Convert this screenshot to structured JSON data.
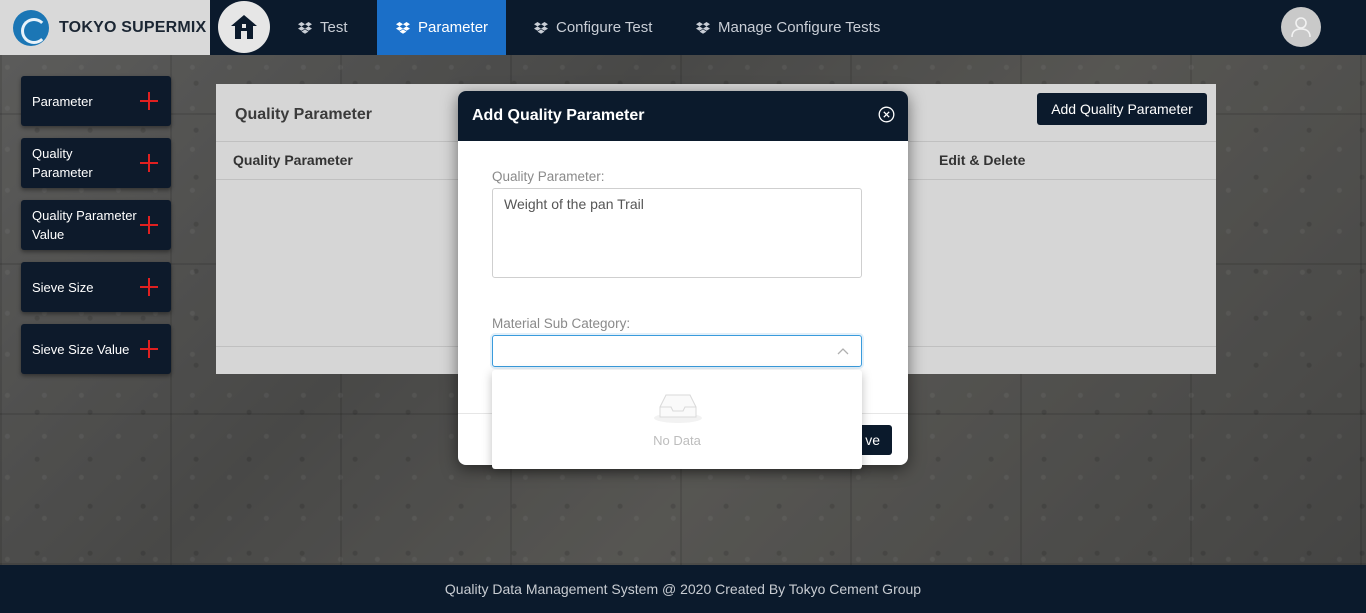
{
  "brand": {
    "name": "TOKYO SUPERMIX",
    "logo_icon": "spiral-logo-icon"
  },
  "nav": {
    "home_icon": "home-icon",
    "items": [
      {
        "label": "Test",
        "icon": "dropbox-icon",
        "active": false
      },
      {
        "label": "Parameter",
        "icon": "dropbox-icon",
        "active": true
      },
      {
        "label": "Configure Test",
        "icon": "dropbox-icon",
        "active": false
      },
      {
        "label": "Manage Configure Tests",
        "icon": "dropbox-icon",
        "active": false
      }
    ],
    "avatar_icon": "user-icon"
  },
  "sidebar": {
    "items": [
      {
        "label": "Parameter",
        "icon": "plus-icon"
      },
      {
        "label": "Quality Parameter",
        "icon": "plus-icon"
      },
      {
        "label": "Quality Parameter Value",
        "icon": "plus-icon"
      },
      {
        "label": "Sieve Size",
        "icon": "plus-icon"
      },
      {
        "label": "Sieve Size Value",
        "icon": "plus-icon"
      }
    ]
  },
  "card": {
    "title": "Quality Parameter",
    "add_button": "Add Quality Parameter",
    "columns": [
      "Quality Parameter",
      "Edit & Delete"
    ]
  },
  "modal": {
    "title": "Add Quality Parameter",
    "close_icon": "close-circle-icon",
    "quality_parameter_label": "Quality Parameter:",
    "quality_parameter_value": "Weight of the pan Trail",
    "material_sub_category_label": "Material Sub Category:",
    "material_sub_category_value": "",
    "save_label": "Save",
    "save_visible_text": "ve"
  },
  "dropdown": {
    "empty_text": "No Data",
    "empty_icon": "empty-inbox-icon"
  },
  "footer": {
    "text": "Quality Data Management System @ 2020 Created By Tokyo Cement Group"
  },
  "colors": {
    "navbar": "#0b1a2c",
    "active_tab": "#1b6fc8",
    "plus": "#e02020",
    "focus_border": "#3a9bdc"
  }
}
